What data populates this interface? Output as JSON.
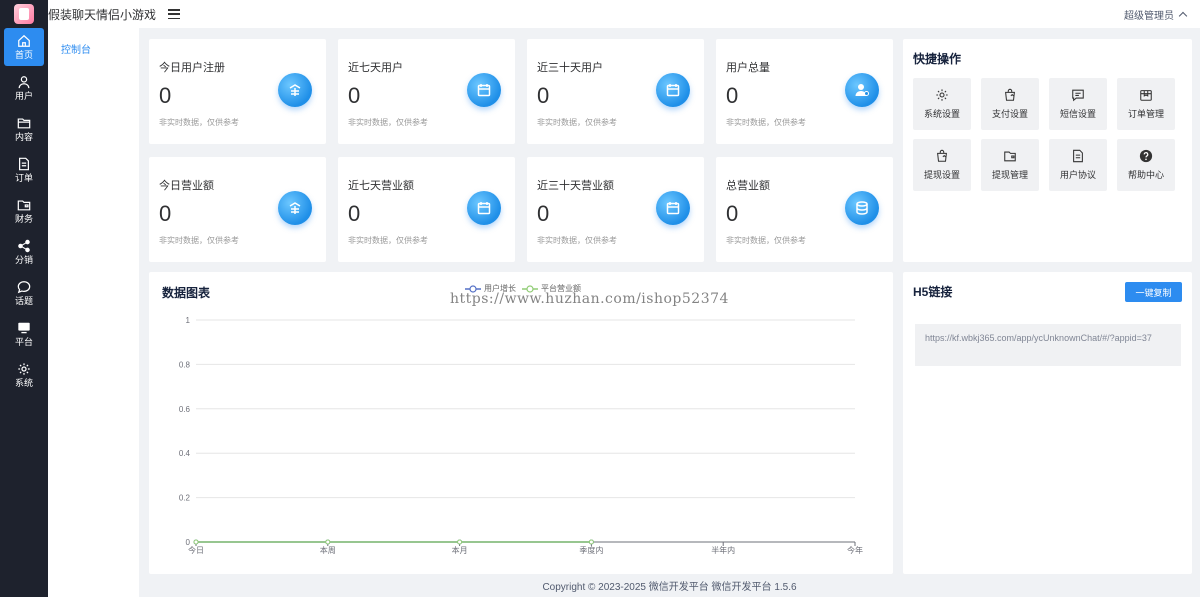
{
  "app": {
    "title": "假装聊天情侣小游戏",
    "user": "超级管理员"
  },
  "rail": [
    {
      "label": "首页",
      "icon": "home-icon",
      "active": true
    },
    {
      "label": "用户",
      "icon": "user-icon"
    },
    {
      "label": "内容",
      "icon": "folder-icon"
    },
    {
      "label": "订单",
      "icon": "document-icon"
    },
    {
      "label": "财务",
      "icon": "wallet-icon"
    },
    {
      "label": "分销",
      "icon": "share-icon"
    },
    {
      "label": "话题",
      "icon": "chat-icon"
    },
    {
      "label": "平台",
      "icon": "monitor-icon"
    },
    {
      "label": "系统",
      "icon": "gear-icon"
    }
  ],
  "submenu": {
    "active": "控制台"
  },
  "stats": [
    {
      "title": "今日用户注册",
      "value": "0",
      "note": "非实时数据，仅供参考",
      "icon": "coin-icon"
    },
    {
      "title": "近七天用户",
      "value": "0",
      "note": "非实时数据，仅供参考",
      "icon": "calendar-icon"
    },
    {
      "title": "近三十天用户",
      "value": "0",
      "note": "非实时数据，仅供参考",
      "icon": "calendar-icon"
    },
    {
      "title": "用户总量",
      "value": "0",
      "note": "非实时数据，仅供参考",
      "icon": "user-add-icon"
    },
    {
      "title": "今日营业额",
      "value": "0",
      "note": "非实时数据，仅供参考",
      "icon": "coin-icon"
    },
    {
      "title": "近七天营业额",
      "value": "0",
      "note": "非实时数据，仅供参考",
      "icon": "calendar-icon"
    },
    {
      "title": "近三十天营业额",
      "value": "0",
      "note": "非实时数据，仅供参考",
      "icon": "calendar-icon"
    },
    {
      "title": "总营业额",
      "value": "0",
      "note": "非实时数据，仅供参考",
      "icon": "database-icon"
    }
  ],
  "quick": {
    "title": "快捷操作",
    "items": [
      {
        "label": "系统设置",
        "icon": "gear-icon"
      },
      {
        "label": "支付设置",
        "icon": "bag-icon"
      },
      {
        "label": "短信设置",
        "icon": "message-icon"
      },
      {
        "label": "订单管理",
        "icon": "package-icon"
      },
      {
        "label": "提现设置",
        "icon": "bag-icon"
      },
      {
        "label": "提现管理",
        "icon": "wallet-icon"
      },
      {
        "label": "用户协议",
        "icon": "document-icon"
      },
      {
        "label": "帮助中心",
        "icon": "help-icon"
      }
    ]
  },
  "chart_panel": {
    "title": "数据图表",
    "watermark": "https://www.huzhan.com/ishop52374"
  },
  "chart_data": {
    "type": "line",
    "categories": [
      "今日",
      "本周",
      "本月",
      "季度内",
      "半年内",
      "今年"
    ],
    "series": [
      {
        "name": "用户增长",
        "values": [
          0,
          0,
          0,
          0,
          null,
          null
        ],
        "color": "#5470c6"
      },
      {
        "name": "平台营业额",
        "values": [
          0,
          0,
          0,
          0,
          null,
          null
        ],
        "color": "#91cc75"
      }
    ],
    "ylim": [
      0,
      1
    ],
    "yticks": [
      "0",
      "0.2",
      "0.4",
      "0.6",
      "0.8",
      "1"
    ],
    "grid": true,
    "legend": "top-center"
  },
  "h5": {
    "title": "H5链接",
    "button": "一键复制",
    "url": "https://kf.wbkj365.com/app/ycUnknownChat/#/?appid=37"
  },
  "footer": "Copyright © 2023-2025 微信开发平台  微信开发平台 1.5.6",
  "colors": {
    "accent": "#2d8cf0",
    "rail": "#1e222d"
  }
}
